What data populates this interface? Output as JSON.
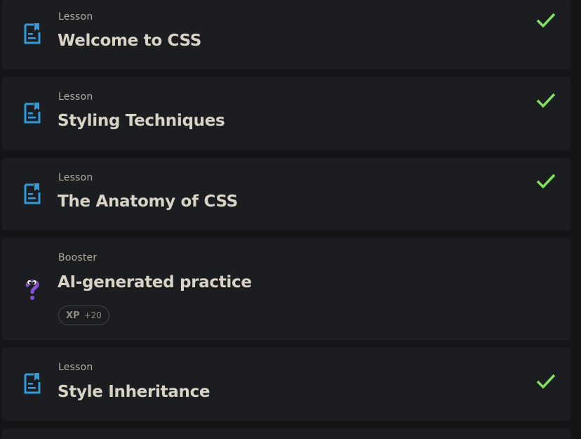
{
  "colors": {
    "background": "#141517",
    "card": "#1c1d20",
    "lesson_icon": "#2e9bdc",
    "check": "#7ee45a",
    "booster_icon": "#8a4fd6"
  },
  "items": [
    {
      "type": "Lesson",
      "title": "Welcome to CSS",
      "icon": "lesson-document-icon",
      "completed": true
    },
    {
      "type": "Lesson",
      "title": "Styling Techniques",
      "icon": "lesson-document-icon",
      "completed": true
    },
    {
      "type": "Lesson",
      "title": "The Anatomy of CSS",
      "icon": "lesson-document-icon",
      "completed": true
    },
    {
      "type": "Booster",
      "title": "AI-generated practice",
      "icon": "question-mark-mascot-icon",
      "completed": false,
      "xp_label": "XP",
      "xp_value": "+20"
    },
    {
      "type": "Lesson",
      "title": "Style Inheritance",
      "icon": "lesson-document-icon",
      "completed": true
    }
  ]
}
